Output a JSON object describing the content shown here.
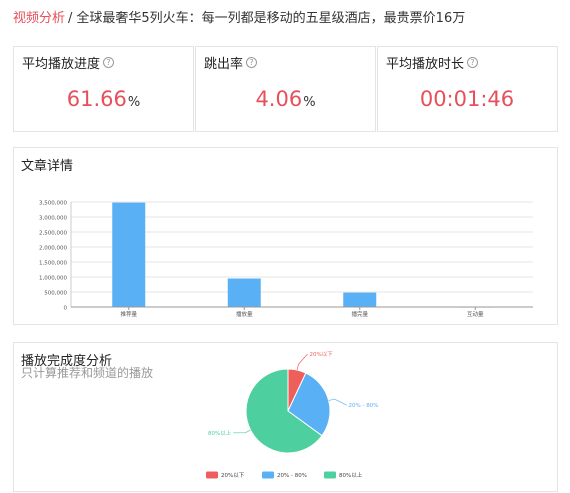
{
  "breadcrumb": {
    "root": "视频分析",
    "separator": "/",
    "title": "全球最奢华5列火车：每一列都是移动的五星级酒店，最贵票价16万"
  },
  "stats": [
    {
      "label": "平均播放进度",
      "value": "61.66",
      "unit": "%"
    },
    {
      "label": "跳出率",
      "value": "4.06",
      "unit": "%"
    },
    {
      "label": "平均播放时长",
      "value": "00:01:46",
      "unit": ""
    }
  ],
  "help_icon_glyph": "?",
  "details": {
    "title": "文章详情"
  },
  "completion": {
    "title": "播放完成度分析",
    "subtitle": "只计算推荐和频道的播放"
  },
  "colors": {
    "accent": "#e6505a",
    "bar": "#5ab0f5",
    "pie_low": "#ee5f5b",
    "pie_mid": "#5ab0f5",
    "pie_high": "#4dcfa0"
  },
  "chart_data": [
    {
      "type": "bar",
      "title": "",
      "categories": [
        "推荐量",
        "播放量",
        "播完量",
        "互动量"
      ],
      "values": [
        3480000,
        950000,
        480000,
        15000
      ],
      "ylim": [
        0,
        3500000
      ],
      "yticks": [
        "0",
        "500,000",
        "1,000,000",
        "1,500,000",
        "2,000,000",
        "2,500,000",
        "3,000,000",
        "3,500,000"
      ],
      "grid": true
    },
    {
      "type": "pie",
      "labels": [
        "20%以下",
        "20% - 80%",
        "80%以上"
      ],
      "values": [
        7,
        28,
        65
      ],
      "legend": "bottom"
    }
  ]
}
